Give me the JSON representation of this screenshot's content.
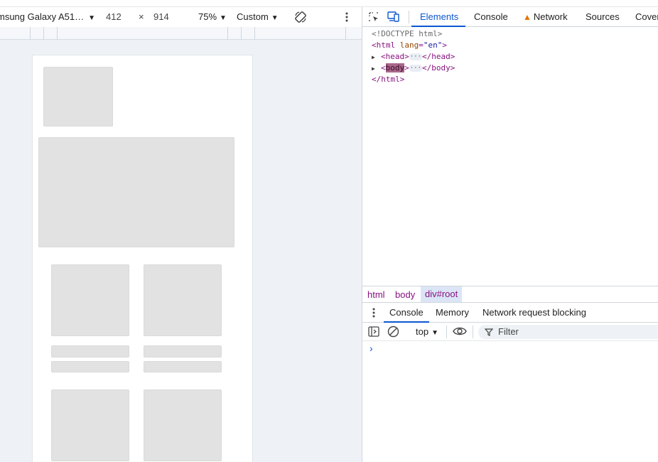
{
  "device_toolbar": {
    "device_name": "msung Galaxy A51…",
    "width": "412",
    "times": "×",
    "height": "914",
    "zoom": "75%",
    "throttle": "Custom"
  },
  "devtools": {
    "tabs": [
      "Elements",
      "Console",
      "Network",
      "Sources",
      "Cover"
    ],
    "active_tab": "Elements",
    "dom_lines": {
      "doctype": "<!DOCTYPE html>",
      "html_open_tag": "<html",
      "html_attr": "lang",
      "html_attr_val": "\"en\"",
      "html_close": ">",
      "head_open": "<head>",
      "head_close": "</head>",
      "body_lt": "<",
      "body_name": "body",
      "body_gt": ">",
      "body_close": "</body>",
      "html_end": "</html>",
      "ellipsis": "···"
    },
    "breadcrumbs": [
      "html",
      "body",
      "div#root"
    ],
    "drawer_tabs": [
      "Console",
      "Memory",
      "Network request blocking"
    ],
    "console": {
      "context": "top",
      "filter_placeholder": "Filter",
      "prompt": "›"
    }
  },
  "colors": {
    "accent": "#0b57d0",
    "skeleton": "#e2e2e2",
    "tag": "#881280",
    "warning": "#e37400"
  }
}
